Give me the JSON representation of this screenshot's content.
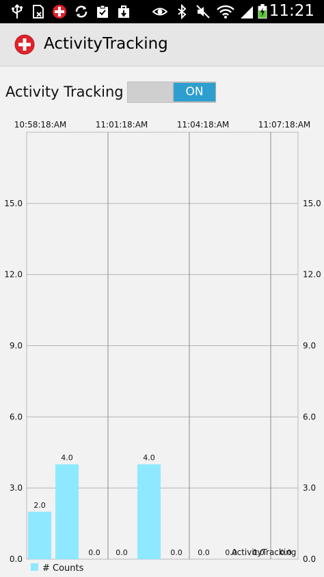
{
  "status_bar": {
    "time": "11:21",
    "icons": [
      "usb-icon",
      "sim-icon",
      "app-notification-icon",
      "sync-icon",
      "clipboard-check-icon",
      "bag-icon",
      "eye-icon",
      "bluetooth-icon",
      "mute-icon",
      "wifi-icon",
      "signal-icon",
      "battery-charging-icon"
    ]
  },
  "app_bar": {
    "title": "ActivityTracking",
    "icon": "red-cross-plus-icon"
  },
  "toggle": {
    "label": "Activity Tracking",
    "state_text": "ON",
    "is_on": true,
    "on_color": "#2e9ecf"
  },
  "chart_data": {
    "type": "bar",
    "x_tick_labels": [
      "10:58:18:AM",
      "11:01:18:AM",
      "11:04:18:AM",
      "11:07:18:AM"
    ],
    "y_ticks": [
      "0.0",
      "3.0",
      "6.0",
      "9.0",
      "12.0",
      "15.0"
    ],
    "ylim": [
      0,
      18
    ],
    "values": [
      2.0,
      4.0,
      0.0,
      0.0,
      4.0,
      0.0,
      0.0,
      0.0,
      0.0,
      0.0
    ],
    "value_labels": [
      "2.0",
      "4.0",
      "0.0",
      "0.0",
      "4.0",
      "0.0",
      "0.0",
      "0.0",
      "0.0",
      "0.0"
    ],
    "series": [
      {
        "name": "# Counts",
        "color": "#8ee8ff"
      }
    ],
    "annotation": "ActivityTracking",
    "grid": true,
    "legend_position": "bottom-left"
  }
}
